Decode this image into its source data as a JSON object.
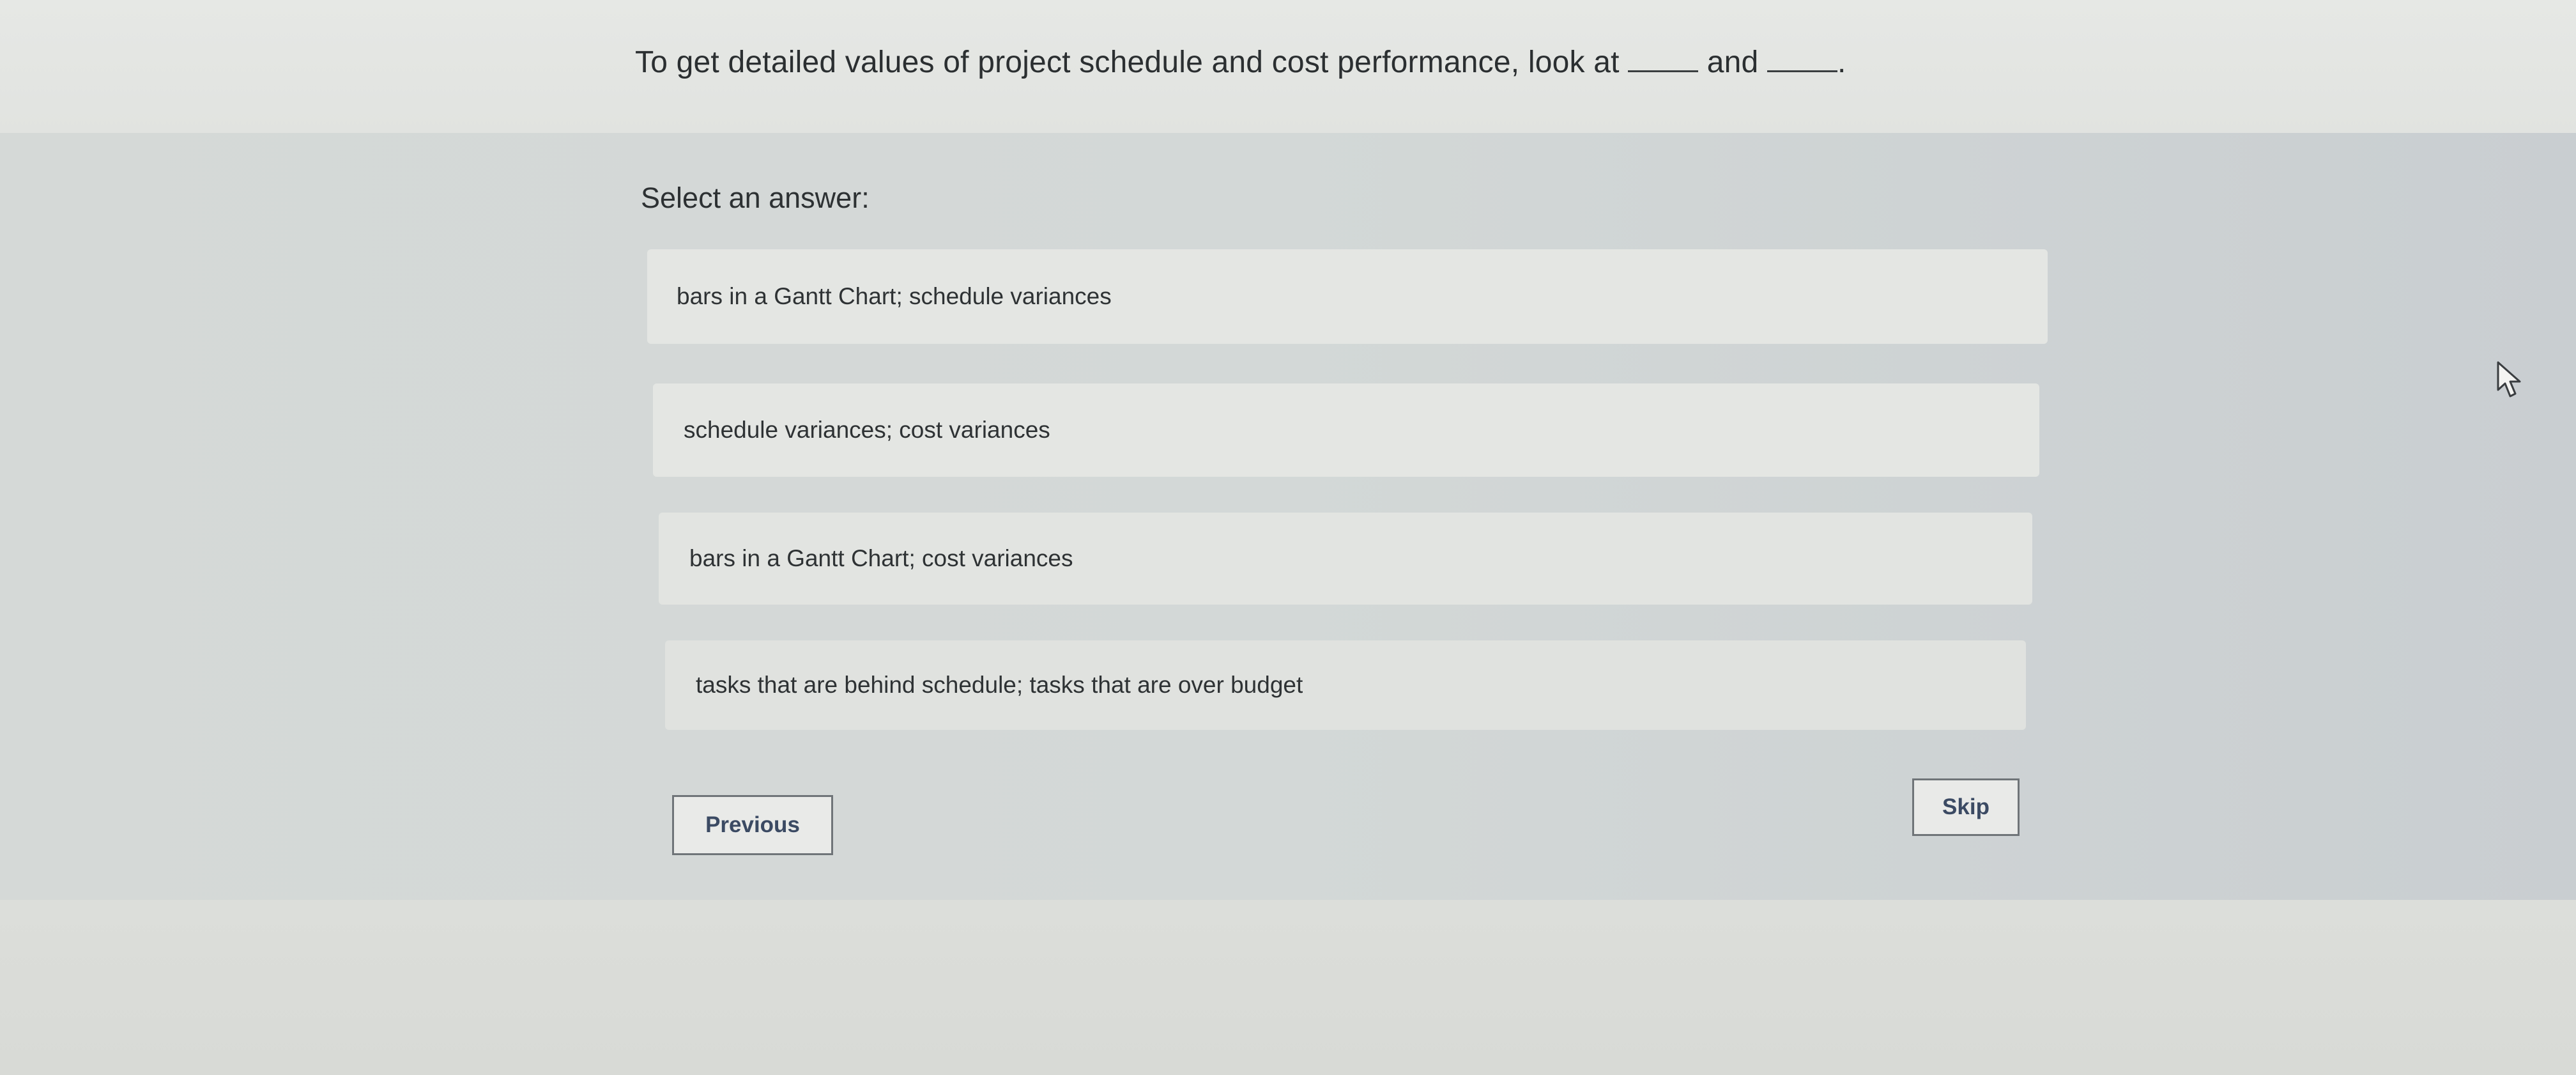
{
  "question": {
    "text_part1": "To get detailed values of project schedule and cost performance, look at",
    "text_and": "and",
    "text_end": "."
  },
  "prompt": {
    "label": "Select an answer:"
  },
  "options": [
    {
      "label": "bars in a Gantt Chart; schedule variances"
    },
    {
      "label": "schedule variances; cost variances"
    },
    {
      "label": "bars in a Gantt Chart; cost variances"
    },
    {
      "label": "tasks that are behind schedule; tasks that are over budget"
    }
  ],
  "navigation": {
    "previous_label": "Previous",
    "skip_label": "Skip"
  },
  "icons": {
    "cursor": "mouse-pointer-icon"
  },
  "colors": {
    "button_text": "#3b4a63",
    "option_background": "#e4e6e3",
    "panel_background": "#d5d9d7"
  }
}
